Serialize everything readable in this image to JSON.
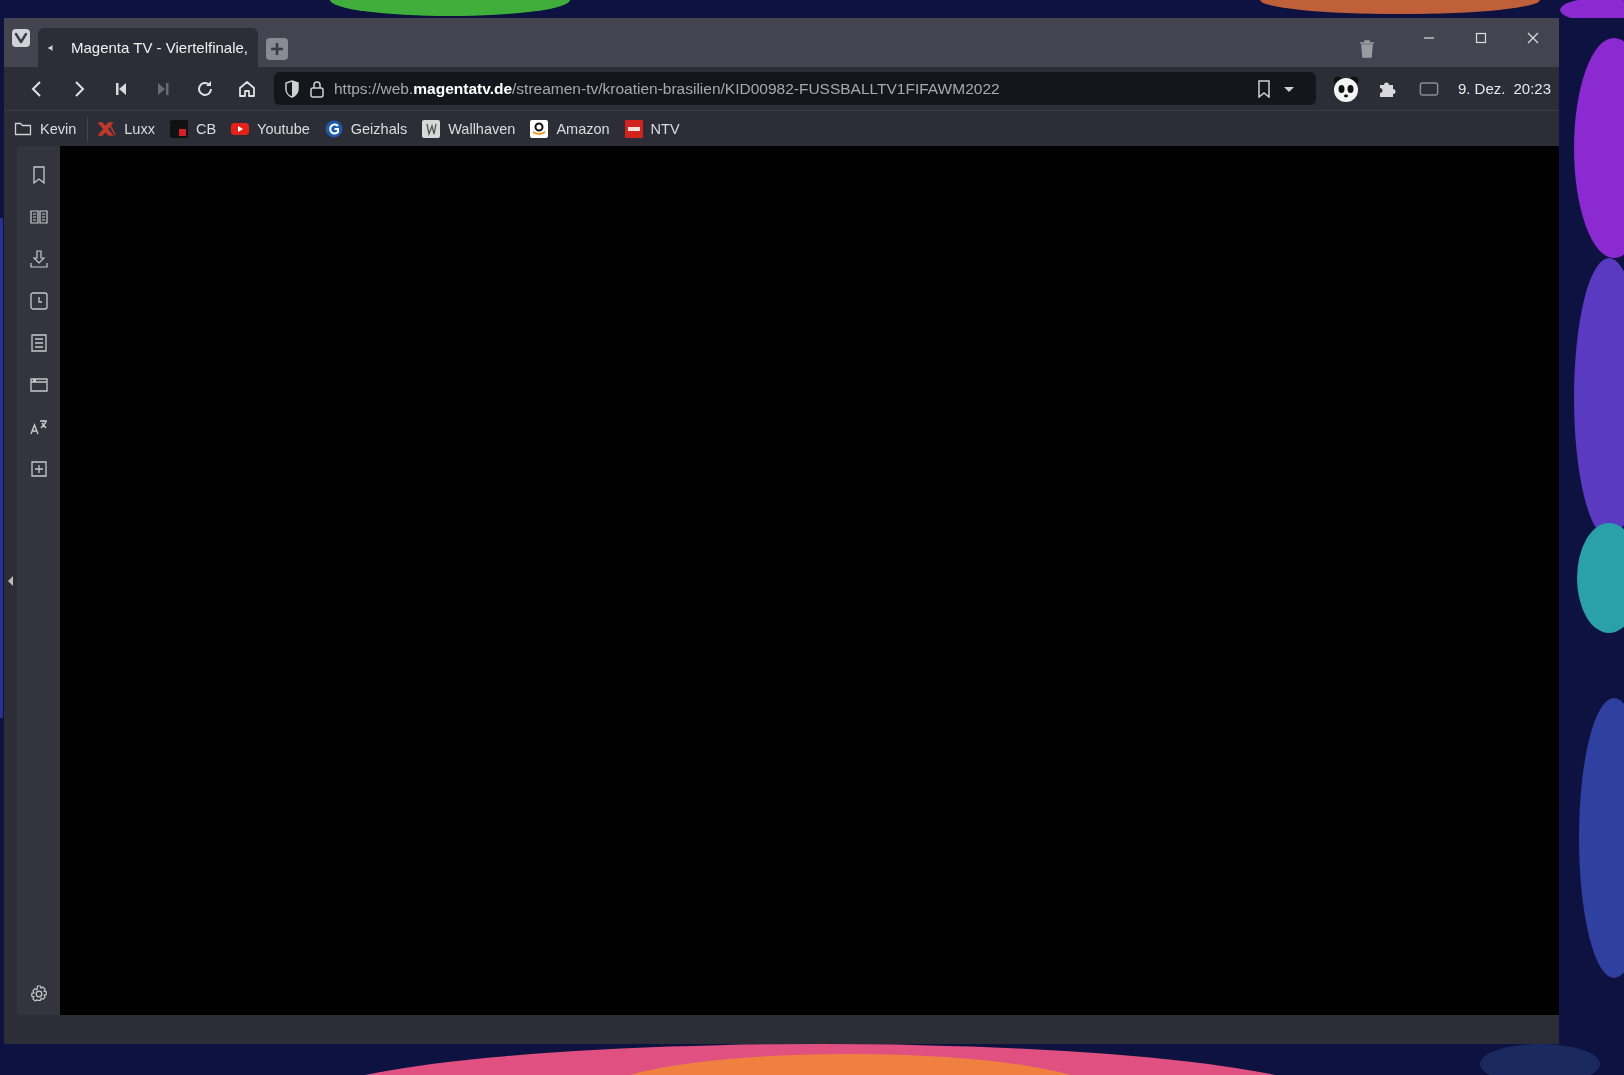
{
  "tabs": [
    {
      "title": "Magenta TV - Viertelfinale,",
      "selected": true,
      "audio": true
    }
  ],
  "address_bar": {
    "url": "https://web.**magentatv.de**/streamen-tv/kroatien-brasilien/KID00982-FUSSBALLTV1FIFAWM2022"
  },
  "clock": {
    "date": "9. Dez.",
    "time": "20:23"
  },
  "bookmarks": [
    {
      "label": "Kevin",
      "kind": "folder"
    },
    {
      "label": "Luxx",
      "kind": "luxx"
    },
    {
      "label": "CB",
      "kind": "cb"
    },
    {
      "label": "Youtube",
      "kind": "youtube"
    },
    {
      "label": "Geizhals",
      "kind": "geizhals"
    },
    {
      "label": "Wallhaven",
      "kind": "wallhaven"
    },
    {
      "label": "Amazon",
      "kind": "amazon"
    },
    {
      "label": "NTV",
      "kind": "ntv"
    }
  ],
  "side_panel": [
    {
      "kind": "bookmarks"
    },
    {
      "kind": "reader"
    },
    {
      "kind": "downloads"
    },
    {
      "kind": "history"
    },
    {
      "kind": "notes"
    },
    {
      "kind": "window"
    },
    {
      "kind": "translate"
    },
    {
      "kind": "add"
    }
  ]
}
